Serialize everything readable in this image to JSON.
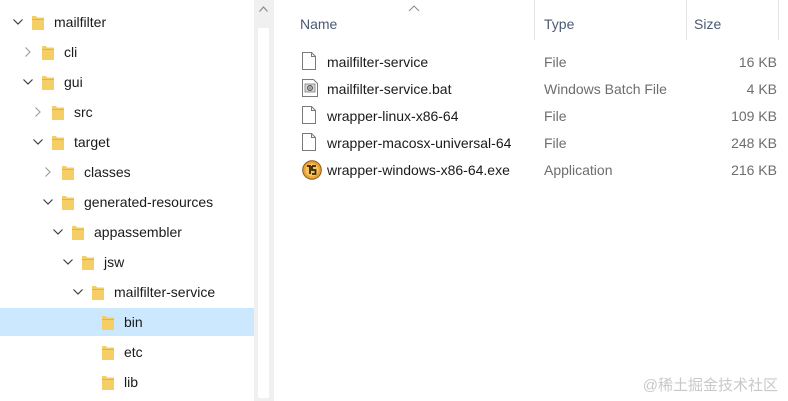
{
  "tree": {
    "items": [
      {
        "label": "mailfilter",
        "expanded": true,
        "selected": false
      },
      {
        "label": "cli",
        "expanded": false,
        "selected": false
      },
      {
        "label": "gui",
        "expanded": true,
        "selected": false
      },
      {
        "label": "src",
        "expanded": false,
        "selected": false
      },
      {
        "label": "target",
        "expanded": true,
        "selected": false
      },
      {
        "label": "classes",
        "expanded": false,
        "selected": false
      },
      {
        "label": "generated-resources",
        "expanded": true,
        "selected": false
      },
      {
        "label": "appassembler",
        "expanded": true,
        "selected": false
      },
      {
        "label": "jsw",
        "expanded": true,
        "selected": false
      },
      {
        "label": "mailfilter-service",
        "expanded": true,
        "selected": false
      },
      {
        "label": "bin",
        "expanded": null,
        "selected": true
      },
      {
        "label": "etc",
        "expanded": null,
        "selected": false
      },
      {
        "label": "lib",
        "expanded": null,
        "selected": false
      }
    ]
  },
  "columns": {
    "name": "Name",
    "type": "Type",
    "size": "Size",
    "sort": "ascending by name"
  },
  "files": [
    {
      "name": "mailfilter-service",
      "type": "File",
      "size": "16 KB",
      "icon": "blank-file-icon"
    },
    {
      "name": "mailfilter-service.bat",
      "type": "Windows Batch File",
      "size": "4 KB",
      "icon": "batch-file-icon"
    },
    {
      "name": "wrapper-linux-x86-64",
      "type": "File",
      "size": "109 KB",
      "icon": "blank-file-icon"
    },
    {
      "name": "wrapper-macosx-universal-64",
      "type": "File",
      "size": "248 KB",
      "icon": "blank-file-icon"
    },
    {
      "name": "wrapper-windows-x86-64.exe",
      "type": "Application",
      "size": "216 KB",
      "icon": "java-app-icon"
    }
  ],
  "watermark": "@稀土掘金技术社区",
  "colors": {
    "selection": "#cce8ff",
    "folder": "#f5cf65",
    "header_text": "#4a5a73",
    "secondary_text": "#6d6d6d"
  }
}
